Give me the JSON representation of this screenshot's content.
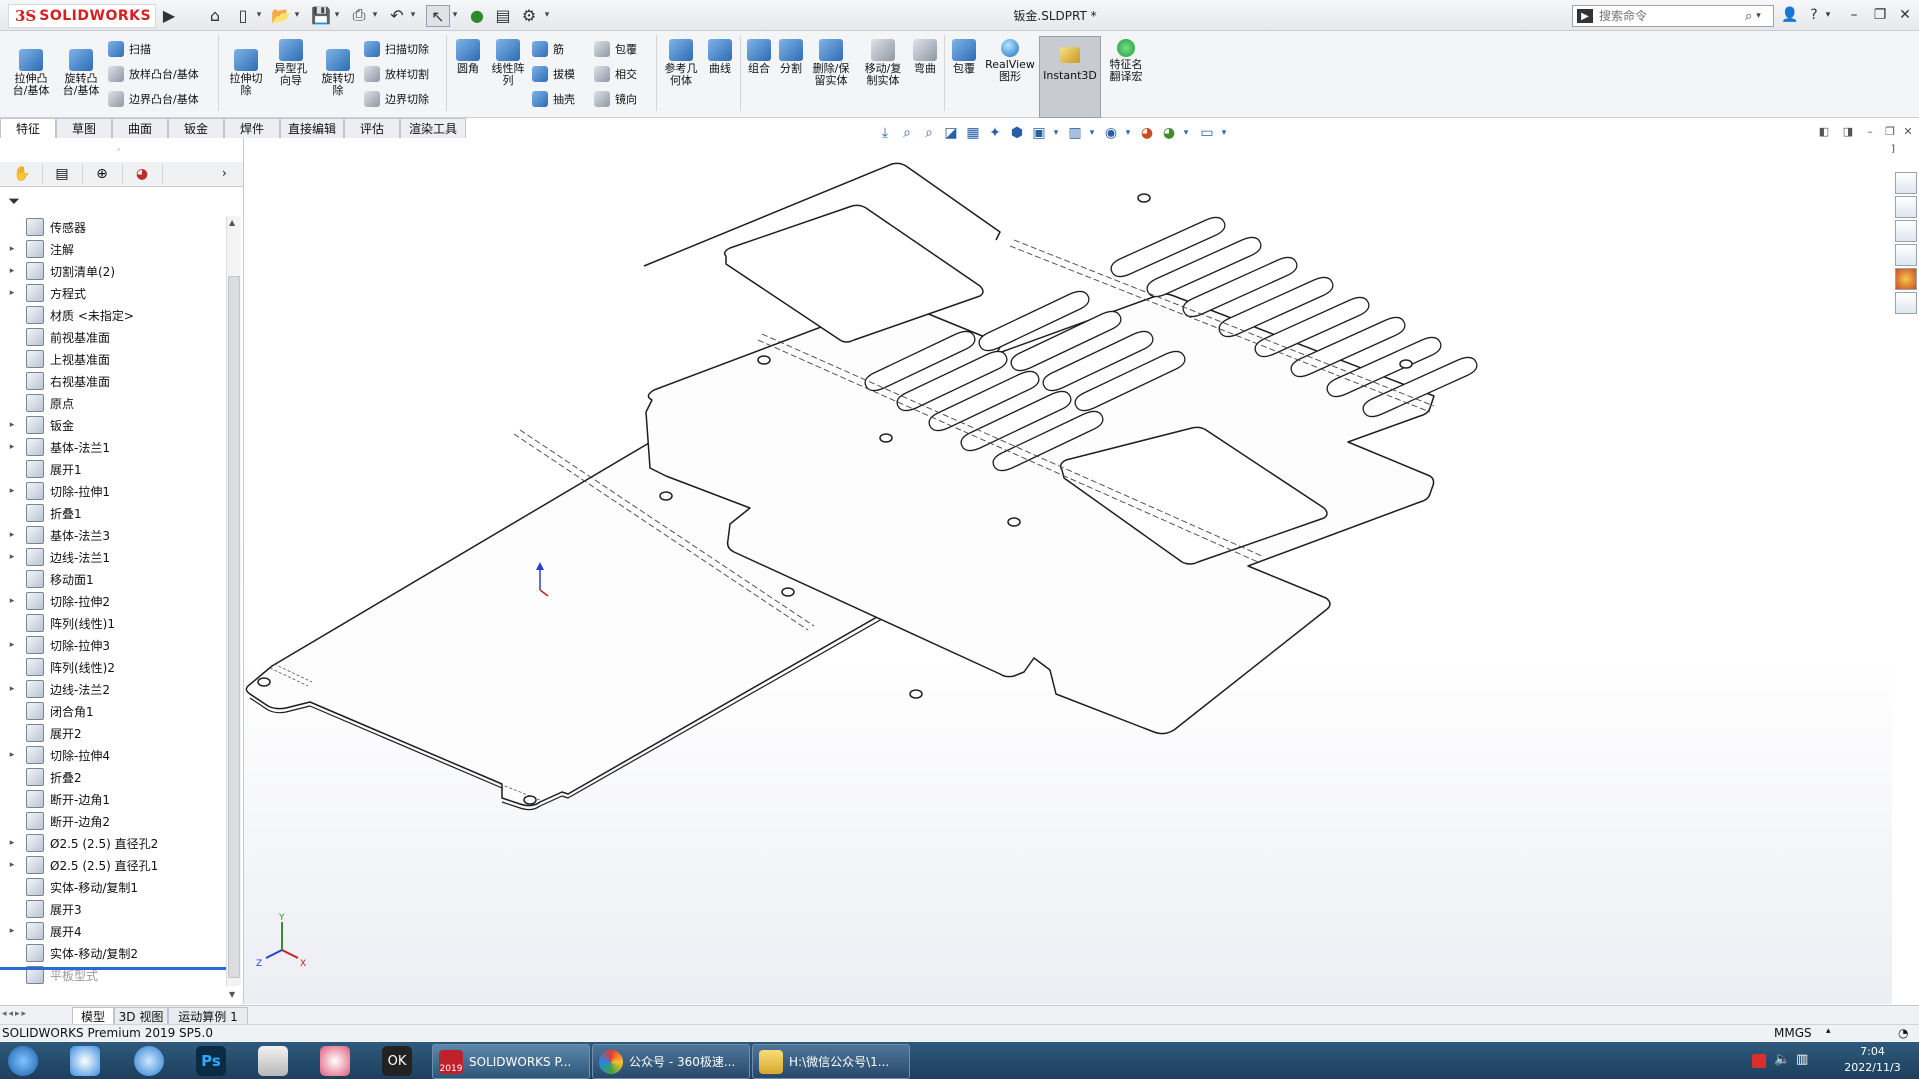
{
  "app": {
    "logo_ds": "3S",
    "logo_name": "SOLIDWORKS",
    "document_title": "钣金.SLDPRT *",
    "search_placeholder": "搜索命令"
  },
  "ribbon": {
    "extrude_boss": "拉伸凸\n台/基体",
    "revolve_boss": "旋转凸\n台/基体",
    "sweep": "扫描",
    "loft_boss": "放样凸台/基体",
    "boundary_boss": "边界凸台/基体",
    "extrude_cut": "拉伸切\n除",
    "hole_wizard": "异型孔\n向导",
    "revolve_cut": "旋转切\n除",
    "swept_cut": "扫描切除",
    "lofted_cut": "放样切割",
    "boundary_cut": "边界切除",
    "fillet": "圆角",
    "linear_pattern": "线性阵\n列",
    "rib": "筋",
    "draft": "拔模",
    "shell": "抽壳",
    "wrap": "包覆",
    "intersect": "相交",
    "mirror": "镜向",
    "ref_geometry": "参考几\n何体",
    "curves": "曲线",
    "combine": "组合",
    "split": "分割",
    "delete_keep_body": "删除/保\n留实体",
    "move_copy_body": "移动/复\n制实体",
    "flex": "弯曲",
    "wrap2": "包覆",
    "realview": "RealView\n图形",
    "instant3d": "Instant3D",
    "feature_works": "特征名\n翻译宏"
  },
  "tabs": [
    "特征",
    "草图",
    "曲面",
    "钣金",
    "焊件",
    "直接编辑",
    "评估",
    "渲染工具"
  ],
  "tree": [
    {
      "label": "传感器",
      "expand": ""
    },
    {
      "label": "注解",
      "expand": "▸"
    },
    {
      "label": "切割清单(2)",
      "expand": "▸"
    },
    {
      "label": "方程式",
      "expand": "▸"
    },
    {
      "label": "材质 <未指定>",
      "expand": ""
    },
    {
      "label": "前视基准面",
      "expand": ""
    },
    {
      "label": "上视基准面",
      "expand": ""
    },
    {
      "label": "右视基准面",
      "expand": ""
    },
    {
      "label": "原点",
      "expand": ""
    },
    {
      "label": "钣金",
      "expand": "▸"
    },
    {
      "label": "基体-法兰1",
      "expand": "▸"
    },
    {
      "label": "展开1",
      "expand": ""
    },
    {
      "label": "切除-拉伸1",
      "expand": "▸"
    },
    {
      "label": "折叠1",
      "expand": ""
    },
    {
      "label": "基体-法兰3",
      "expand": "▸"
    },
    {
      "label": "边线-法兰1",
      "expand": "▸"
    },
    {
      "label": "移动面1",
      "expand": ""
    },
    {
      "label": "切除-拉伸2",
      "expand": "▸"
    },
    {
      "label": "阵列(线性)1",
      "expand": ""
    },
    {
      "label": "切除-拉伸3",
      "expand": "▸"
    },
    {
      "label": "阵列(线性)2",
      "expand": ""
    },
    {
      "label": "边线-法兰2",
      "expand": "▸"
    },
    {
      "label": "闭合角1",
      "expand": ""
    },
    {
      "label": "展开2",
      "expand": ""
    },
    {
      "label": "切除-拉伸4",
      "expand": "▸"
    },
    {
      "label": "折叠2",
      "expand": ""
    },
    {
      "label": "断开-边角1",
      "expand": ""
    },
    {
      "label": "断开-边角2",
      "expand": ""
    },
    {
      "label": "Ø2.5 (2.5) 直径孔2",
      "expand": "▸"
    },
    {
      "label": "Ø2.5 (2.5) 直径孔1",
      "expand": "▸"
    },
    {
      "label": "实体-移动/复制1",
      "expand": ""
    },
    {
      "label": "展开3",
      "expand": ""
    },
    {
      "label": "展开4",
      "expand": "▸"
    },
    {
      "label": "实体-移动/复制2",
      "expand": ""
    },
    {
      "label": "平板型式",
      "expand": ""
    }
  ],
  "bottom_tabs": [
    "模型",
    "3D 视图",
    "运动算例 1"
  ],
  "status": {
    "left": "SOLIDWORKS Premium 2019 SP5.0",
    "units": "MMGS"
  },
  "triad": {
    "x": "X",
    "y": "Y",
    "z": "Z"
  },
  "taskbar": {
    "task1": "SOLIDWORKS P...",
    "task1_badge": "2019",
    "task2": "公众号 - 360极速...",
    "task3": "H:\\微信公众号\\1...",
    "time": "7:04",
    "date": "2022/11/3"
  }
}
